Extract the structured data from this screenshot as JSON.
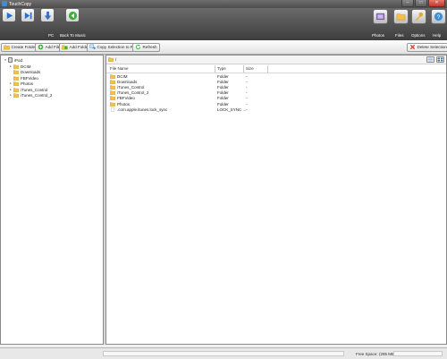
{
  "window": {
    "title": "TouchCopy",
    "controls": [
      "–",
      "□",
      "✕"
    ]
  },
  "toolbar": {
    "left_buttons": [
      {
        "icon": "play-icon",
        "label": ""
      },
      {
        "icon": "skip-forward-icon",
        "label": ""
      },
      {
        "icon": "download-arrow-icon",
        "label": ""
      },
      {
        "icon": "back-green-arrow-icon",
        "label": ""
      }
    ],
    "left_labels": [
      "PC",
      "Back To Music"
    ],
    "right_buttons": [
      {
        "icon": "photos-icon",
        "label": "Photos"
      },
      {
        "icon": "files-icon",
        "label": "Files"
      },
      {
        "icon": "options-icon",
        "label": "Options"
      },
      {
        "icon": "help-icon",
        "label": "Help"
      }
    ]
  },
  "actions": {
    "create_folder": "Create Folder",
    "add_file": "Add File",
    "add_folder": "Add Folder",
    "copy_to_pc": "Copy Selection to PC",
    "refresh": "Refresh",
    "delete_selection": "Delete Selection"
  },
  "tree": {
    "root": "iPod",
    "children": [
      "DCIM",
      "Downloads",
      "FBFVideo",
      "Photos",
      "iTunes_Control",
      "iTunes_Control_2"
    ]
  },
  "file_panel": {
    "path": "/",
    "columns": {
      "name": "File Name",
      "type": "Type",
      "size": "Size"
    },
    "rows": [
      {
        "name": "DCIM",
        "type": "Folder",
        "size": "-",
        "is_folder": true
      },
      {
        "name": "Downloads",
        "type": "Folder",
        "size": "-",
        "is_folder": true
      },
      {
        "name": "iTunes_Control",
        "type": "Folder",
        "size": "-",
        "is_folder": true
      },
      {
        "name": "iTunes_Control_2",
        "type": "Folder",
        "size": "-",
        "is_folder": true
      },
      {
        "name": "FBFVideo",
        "type": "Folder",
        "size": "-",
        "is_folder": true
      },
      {
        "name": "Photos",
        "type": "Folder",
        "size": "-",
        "is_folder": true
      },
      {
        "name": ".com.apple.itunes.lock_sync",
        "type": "LOCK_SYNC ...",
        "size": "-",
        "is_folder": false
      }
    ]
  },
  "status": {
    "free_space_label": "Free Space:",
    "free_space_value": "(295 MB)",
    "progress": 0
  },
  "colors": {
    "accent": "#3a8fd8",
    "folder": "#f3c244",
    "toolbar_dark": "#4a4a4a"
  }
}
